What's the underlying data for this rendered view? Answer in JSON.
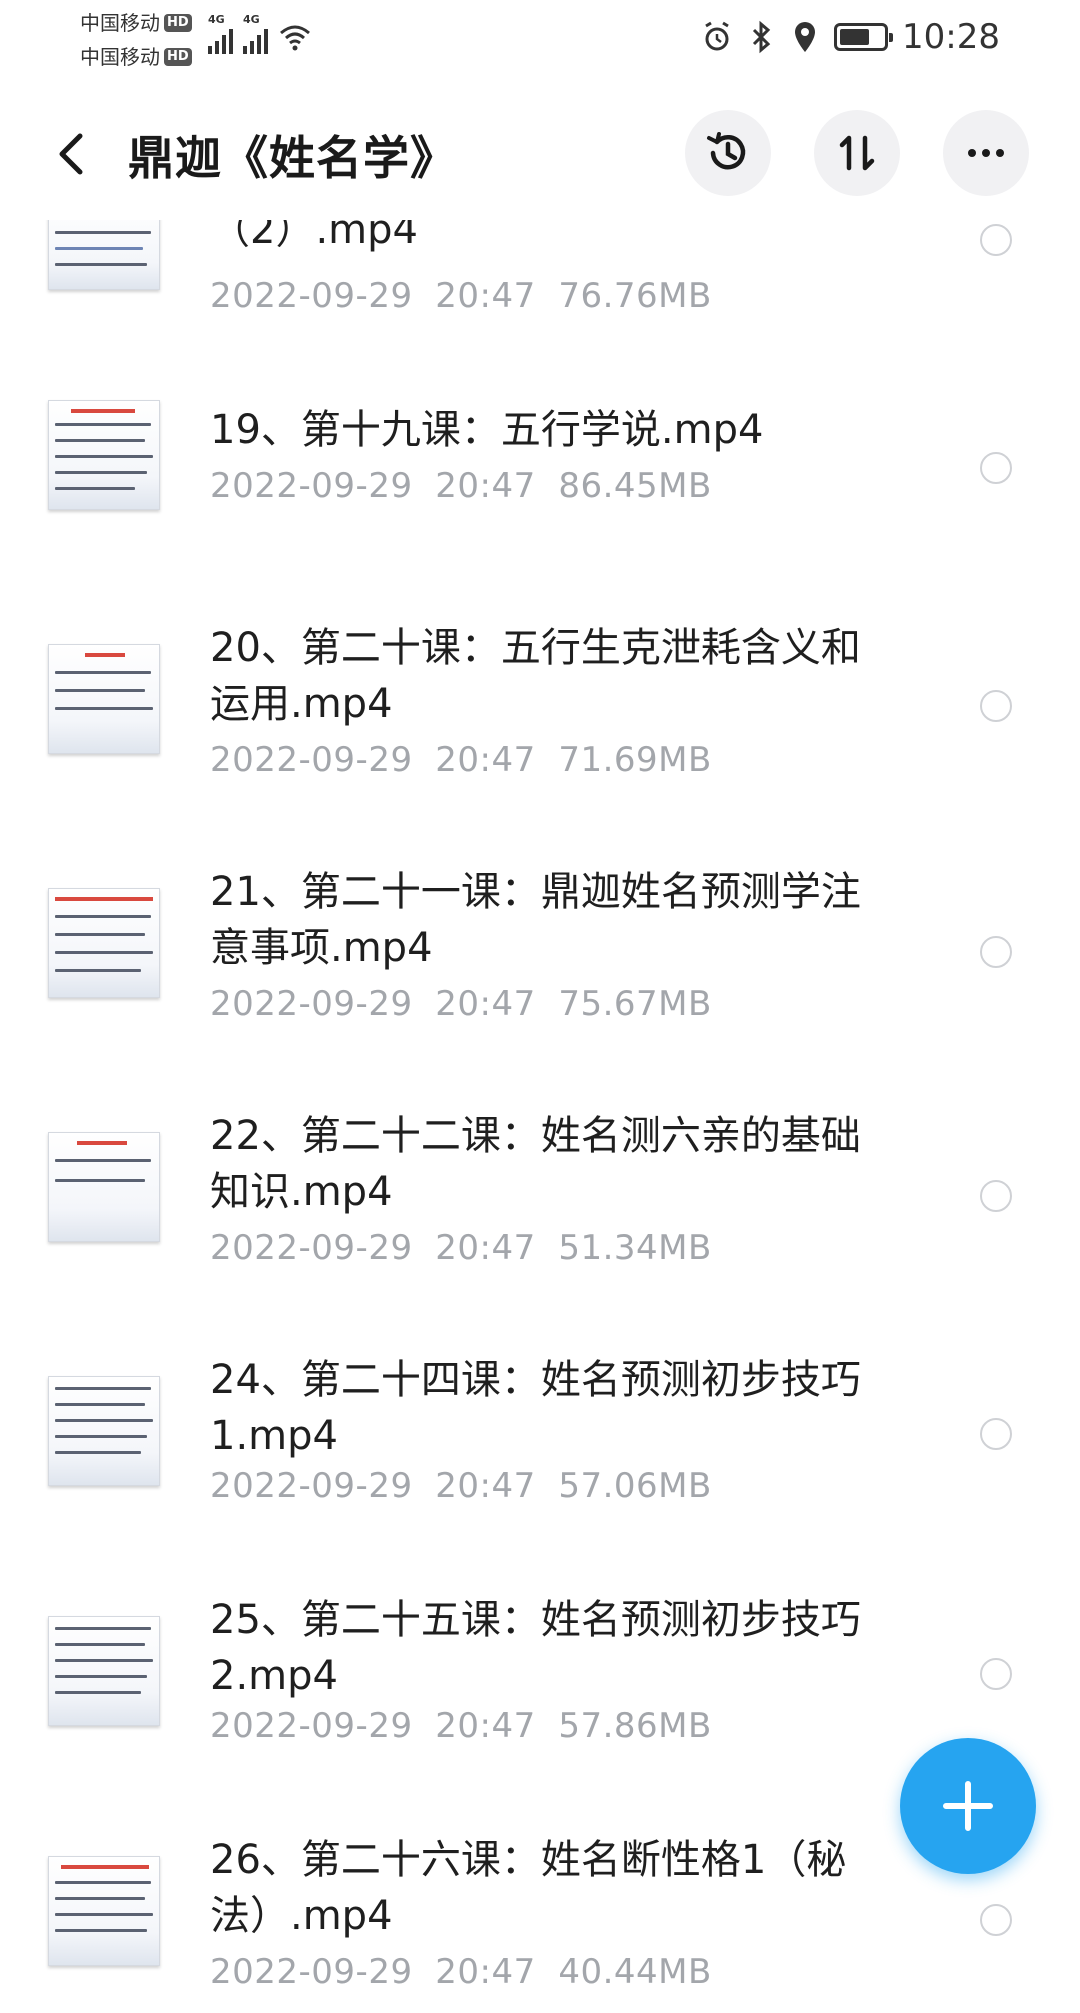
{
  "status_bar": {
    "carrier_1": "中国移动",
    "carrier_2": "中国移动",
    "hd_label": "HD",
    "network_1": "4G",
    "network_2": "4G",
    "time": "10:28",
    "battery_level_percent": 70
  },
  "header": {
    "title": "鼎迦《姓名学》",
    "icons": [
      "back-icon",
      "history-icon",
      "sort-icon",
      "more-icon"
    ]
  },
  "files": [
    {
      "name": "（2）.mp4",
      "date": "2022-09-29",
      "time": "20:47",
      "size": "76.76MB"
    },
    {
      "name": "19、第十九课：五行学说.mp4",
      "date": "2022-09-29",
      "time": "20:47",
      "size": "86.45MB"
    },
    {
      "name": "20、第二十课：五行生克泄耗含义和运用.mp4",
      "date": "2022-09-29",
      "time": "20:47",
      "size": "71.69MB"
    },
    {
      "name": "21、第二十一课：鼎迦姓名预测学注意事项.mp4",
      "date": "2022-09-29",
      "time": "20:47",
      "size": "75.67MB"
    },
    {
      "name": "22、第二十二课：姓名测六亲的基础知识.mp4",
      "date": "2022-09-29",
      "time": "20:47",
      "size": "51.34MB"
    },
    {
      "name": "24、第二十四课：姓名预测初步技巧1.mp4",
      "date": "2022-09-29",
      "time": "20:47",
      "size": "57.06MB"
    },
    {
      "name": "25、第二十五课：姓名预测初步技巧2.mp4",
      "date": "2022-09-29",
      "time": "20:47",
      "size": "57.86MB"
    },
    {
      "name": "26、第二十六课：姓名断性格1（秘法）.mp4",
      "date": "2022-09-29",
      "time": "20:47",
      "size": "40.44MB"
    }
  ],
  "fab": {
    "icon": "plus-icon"
  },
  "colors": {
    "accent": "#26a4f0",
    "meta_text": "#a3a6ab"
  }
}
